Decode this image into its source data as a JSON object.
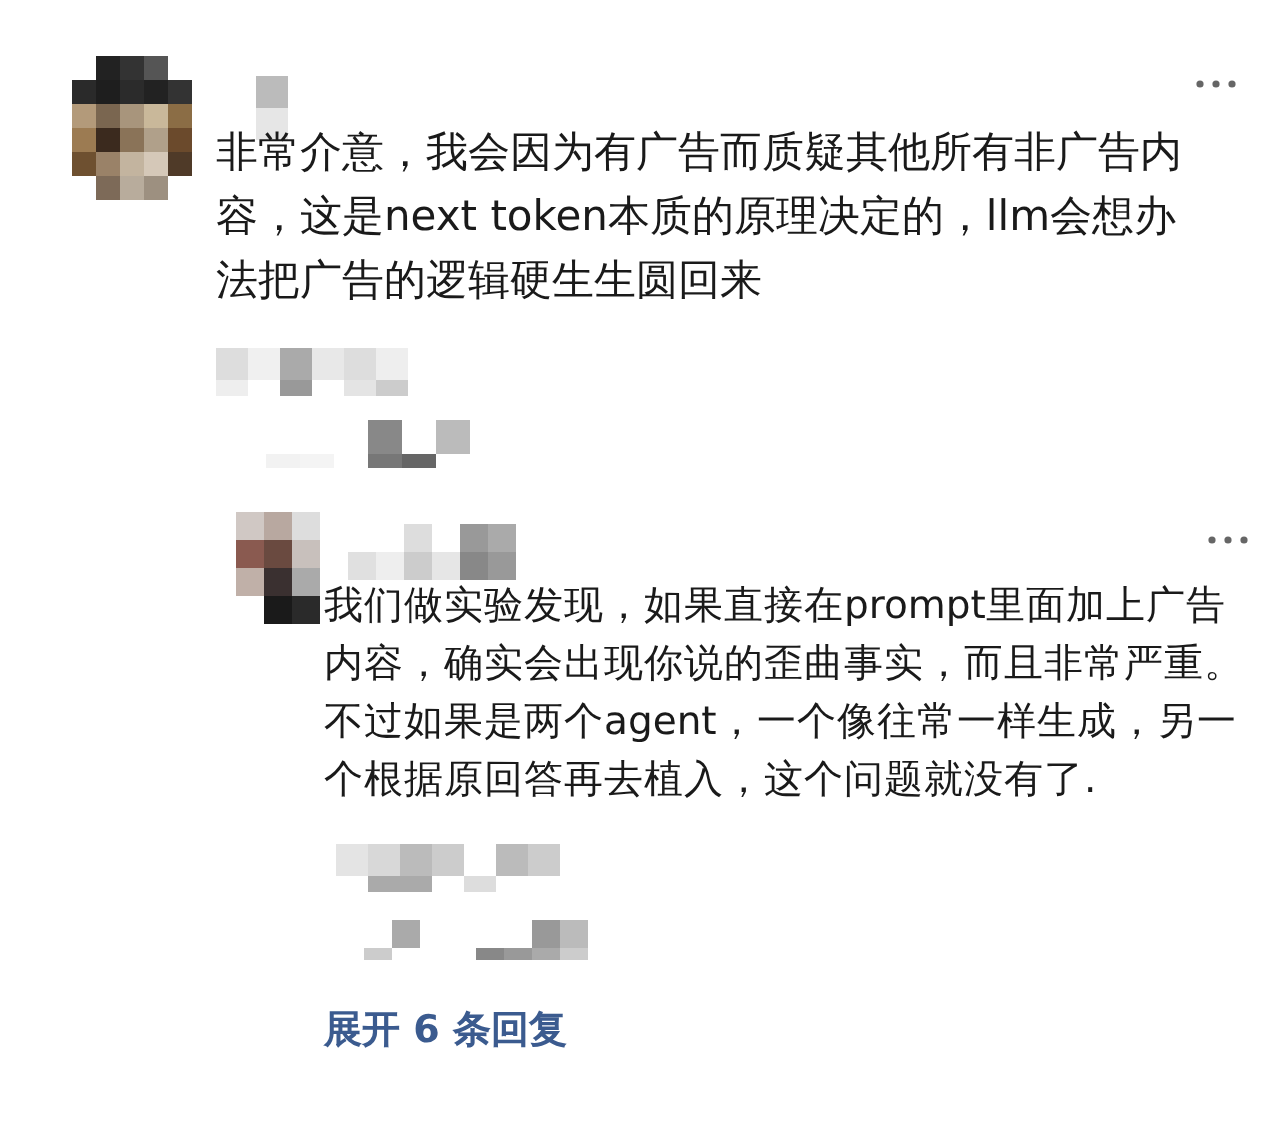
{
  "comment": {
    "text": "非常介意，我会因为有广告而质疑其他所有非广告内容，这是next token本质的原理决定的，llm会想办法把广告的逻辑硬生生圆回来",
    "reply": {
      "text": "我们做实验发现，如果直接在prompt里面加上广告内容，确实会出现你说的歪曲事实，而且非常严重。不过如果是两个agent，一个像往常一样生成，另一个根据原回答再去植入，这个问题就没有了."
    },
    "expand_link": "展开 6 条回复"
  }
}
